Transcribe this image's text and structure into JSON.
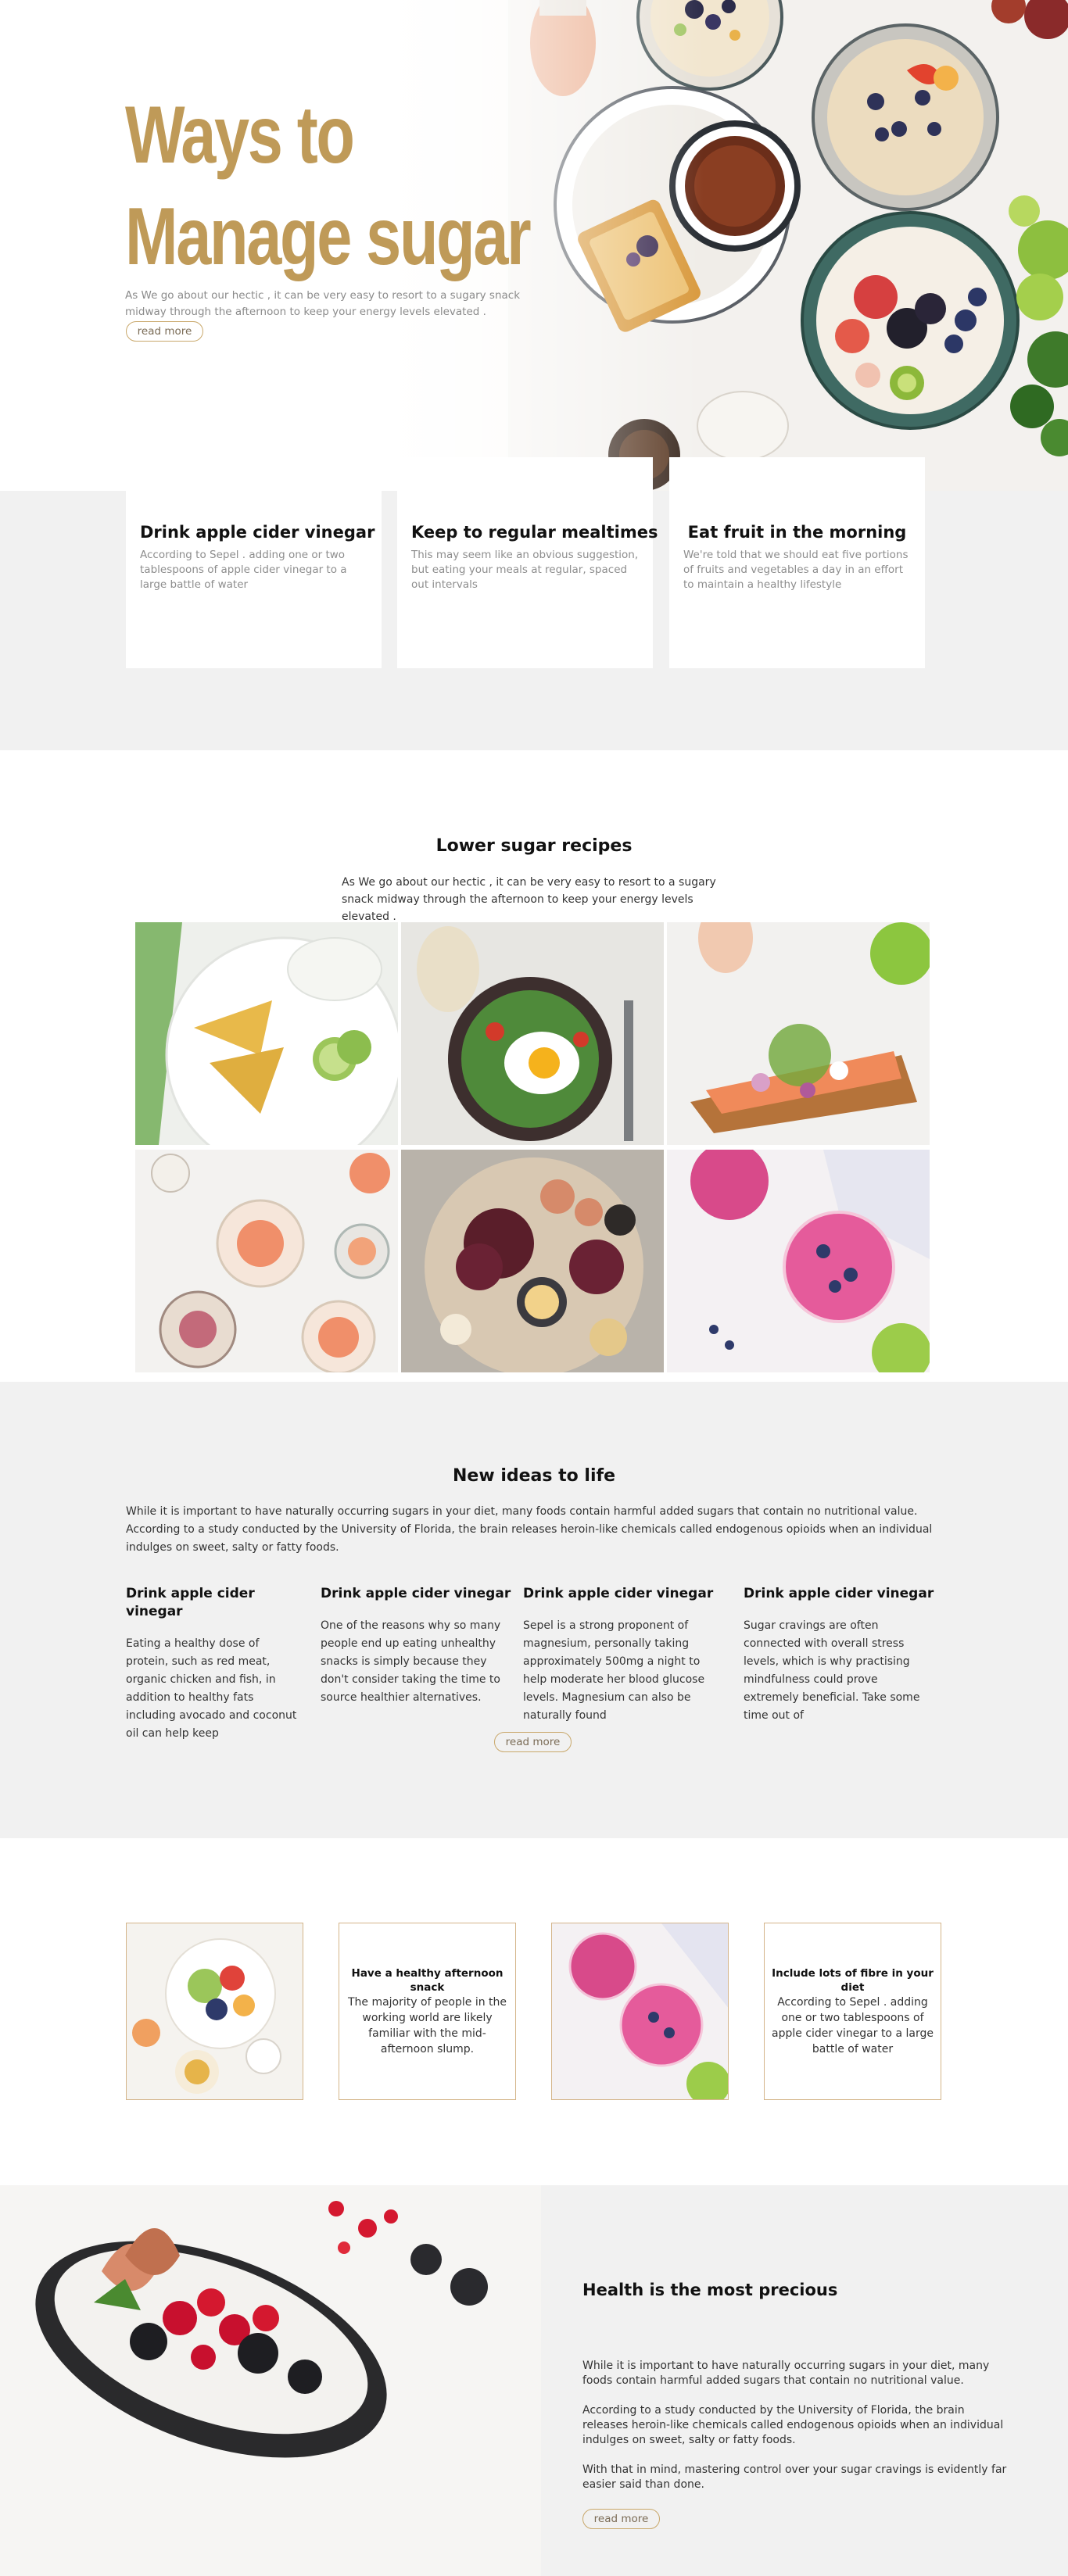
{
  "hero": {
    "title_line1": "Ways to",
    "title_line2": "Manage sugar",
    "subtitle": "As We go about our hectic , it can be very easy to resort to a sugary snack midway through the afternoon to keep your energy levels elevated .",
    "read_more": "read more"
  },
  "features": [
    {
      "title": "Drink apple cider vinegar",
      "text": "According to Sepel . adding one or two tablespoons of apple cider vinegar to a large battle of water"
    },
    {
      "title": "Keep to regular mealtimes",
      "text": "This may seem like an obvious suggestion, but eating your meals at regular, spaced out intervals"
    },
    {
      "title": "Eat fruit in the morning",
      "text": "We're told that we should eat five portions of fruits and vegetables a day in an effort to maintain a healthy lifestyle"
    }
  ],
  "recipes": {
    "title": "Lower sugar recipes",
    "subtitle": "As We go about our hectic , it can be very easy to resort to a sugary snack midway through the afternoon to keep your energy levels elevated ."
  },
  "ideas": {
    "title": "New ideas to life",
    "intro": "While it is important to have naturally occurring sugars in your diet, many foods contain harmful added sugars that contain no nutritional value. According to a study conducted by the University of Florida, the brain releases heroin-like chemicals called endogenous opioids when an individual indulges on sweet, salty or fatty foods.",
    "columns": [
      {
        "title": "Drink apple cider vinegar",
        "text": "Eating a healthy dose of protein, such as red meat, organic chicken and fish, in addition to healthy fats including avocado and coconut oil can help keep"
      },
      {
        "title": "Drink apple cider vinegar",
        "text": "One of the reasons why so many people end up eating unhealthy snacks is simply because they don't consider taking the time to source healthier alternatives."
      },
      {
        "title": "Drink apple cider vinegar",
        "text": "Sepel is a strong proponent of magnesium, personally taking approximately 500mg a night to help moderate her blood glucose levels. Magnesium can also be naturally found"
      },
      {
        "title": "Drink apple cider vinegar",
        "text": "Sugar cravings are often connected with overall stress levels, which is why practising mindfulness could prove extremely beneficial. Take some time out of"
      }
    ],
    "read_more": "read more"
  },
  "tiles": [
    {
      "title": "Have a healthy afternoon snack",
      "text": "The majority of people in the working world are likely familiar with the mid-afternoon slump."
    },
    {
      "title": "Include lots of fibre in your diet",
      "text": "According to Sepel . adding one or two tablespoons of apple cider vinegar to a large battle of water"
    }
  ],
  "health": {
    "title": "Health is the most precious",
    "p1": "While it is important to have naturally occurring sugars in your diet, many foods contain harmful added sugars that contain no nutritional value.",
    "p2": "According to a study conducted by the University of Florida, the brain releases heroin-like chemicals called endogenous opioids when an individual indulges on sweet, salty or fatty foods.",
    "p3": "With that in mind, mastering control over your sugar cravings is evidently far easier said than done.",
    "read_more": "read more"
  },
  "colors": {
    "accent": "#bf9a58",
    "section_bg": "#f1f1f1",
    "tile_border": "#d4b58a"
  }
}
